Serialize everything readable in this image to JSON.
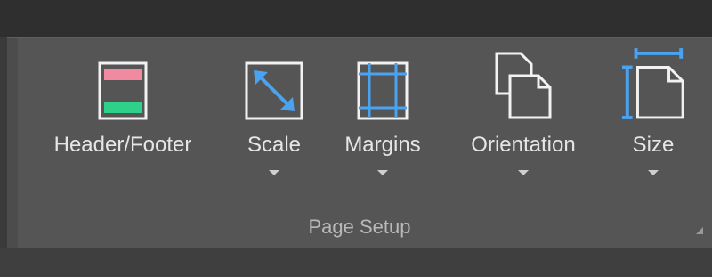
{
  "ribbon": {
    "group_label": "Page Setup",
    "buttons": [
      {
        "label": "Header/Footer",
        "icon": "header-footer-icon"
      },
      {
        "label": "Scale",
        "icon": "scale-icon"
      },
      {
        "label": "Margins",
        "icon": "margins-icon"
      },
      {
        "label": "Orientation",
        "icon": "orientation-icon"
      },
      {
        "label": "Size",
        "icon": "size-icon"
      }
    ]
  },
  "colors": {
    "ribbon_bg": "#555555",
    "accent_blue": "#4aa3f0",
    "header_pink": "#f08aa0",
    "footer_green": "#2ed08a",
    "icon_white": "#f2f2f2"
  }
}
